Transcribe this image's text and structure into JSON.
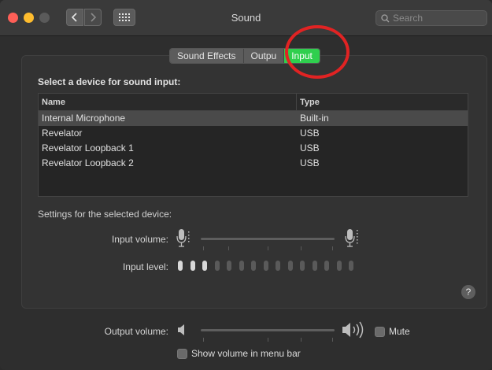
{
  "window": {
    "title": "Sound",
    "search": {
      "placeholder": "Search"
    }
  },
  "tabs": [
    {
      "label": "Sound Effects",
      "active": false
    },
    {
      "label": "Outpu",
      "active": false
    },
    {
      "label": "Input",
      "active": true
    }
  ],
  "input_section": {
    "heading": "Select a device for sound input:",
    "columns": {
      "name": "Name",
      "type": "Type"
    },
    "rows": [
      {
        "name": "Internal Microphone",
        "type": "Built-in",
        "selected": true
      },
      {
        "name": "Revelator",
        "type": "USB",
        "selected": false
      },
      {
        "name": "Revelator Loopback 1",
        "type": "USB",
        "selected": false
      },
      {
        "name": "Revelator Loopback 2",
        "type": "USB",
        "selected": false
      }
    ]
  },
  "settings": {
    "heading": "Settings for the selected device:",
    "input_volume_label": "Input volume:",
    "input_volume": 0.5,
    "input_level_label": "Input level:",
    "input_level_active": 3,
    "input_level_total": 15
  },
  "output": {
    "volume_label": "Output volume:",
    "volume": 0.33,
    "mute_label": "Mute",
    "mute_checked": false,
    "show_volume_label": "Show volume in menu bar",
    "show_volume_checked": false
  },
  "colors": {
    "accent": "#2fcf4e",
    "highlight": "#e12323"
  }
}
